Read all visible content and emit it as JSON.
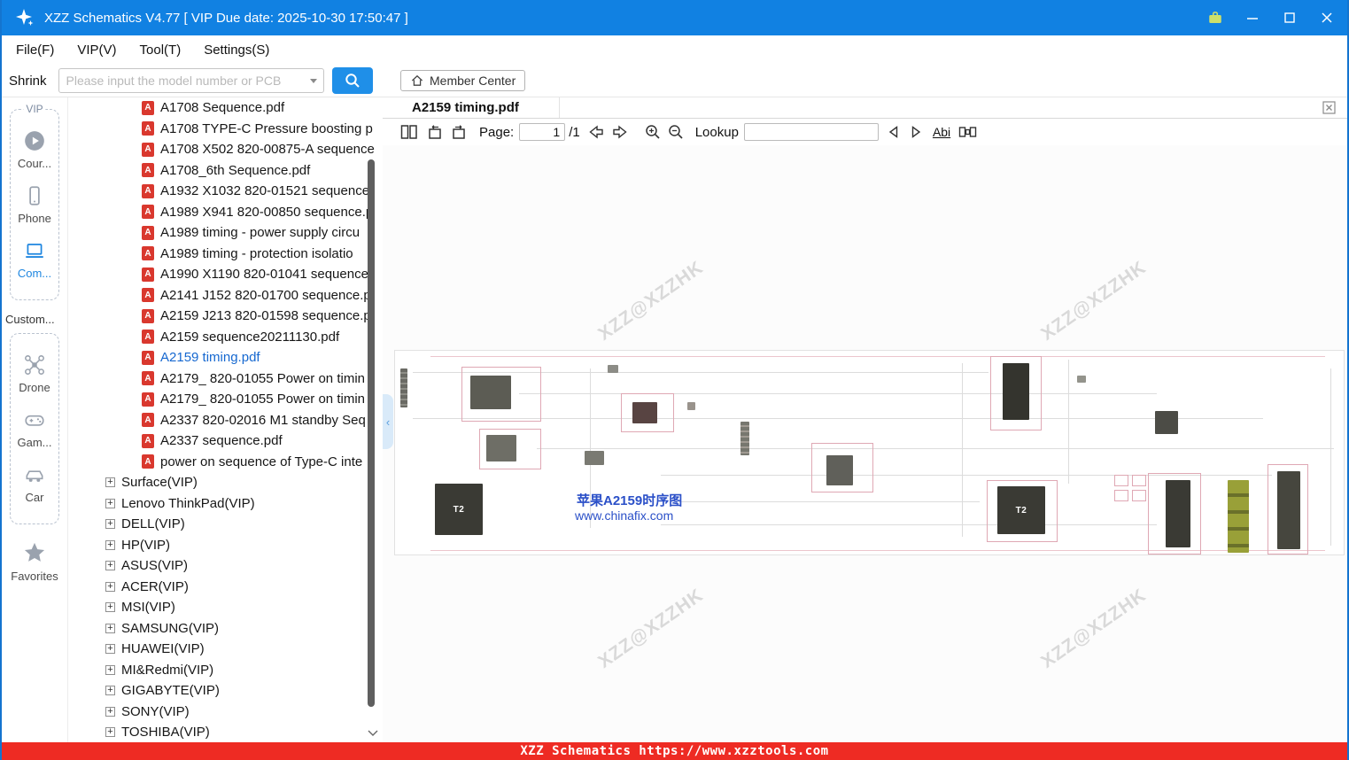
{
  "titlebar": {
    "title": "XZZ Schematics V4.77 [ VIP Due date: 2025-10-30 17:50:47 ]"
  },
  "menubar": {
    "items": [
      "File(F)",
      "VIP(V)",
      "Tool(T)",
      "Settings(S)"
    ]
  },
  "toolbar": {
    "shrink_label": "Shrink",
    "search_placeholder": "Please input the model number or PCB",
    "member_center_label": "Member Center"
  },
  "sidebar": {
    "vip_label": "VIP",
    "courses": "Cour...",
    "phone": "Phone",
    "computer": "Com...",
    "custom_label": "Custom...",
    "drone": "Drone",
    "game": "Gam...",
    "car": "Car",
    "favorites": "Favorites"
  },
  "tree": {
    "files": [
      "A1708 Sequence.pdf",
      "A1708 TYPE-C Pressure boosting p",
      "A1708 X502 820-00875-A sequence",
      "A1708_6th Sequence.pdf",
      "A1932 X1032 820-01521 sequence.",
      "A1989 X941 820-00850 sequence.p",
      "A1989 timing - power supply circu",
      "A1989 timing - protection isolatio",
      "A1990 X1190 820-01041 sequence.",
      "A2141 J152 820-01700 sequence.p",
      "A2159 J213 820-01598 sequence.p",
      "A2159 sequence20211130.pdf",
      "A2159 timing.pdf",
      "A2179_ 820-01055 Power on timin",
      "A2179_ 820-01055 Power on timin",
      "A2337 820-02016 M1 standby Seq",
      "A2337 sequence.pdf",
      "power on sequence of Type-C inte"
    ],
    "folders": [
      "Surface(VIP)",
      "Lenovo ThinkPad(VIP)",
      "DELL(VIP)",
      "HP(VIP)",
      "ASUS(VIP)",
      "ACER(VIP)",
      "MSI(VIP)",
      "SAMSUNG(VIP)",
      "HUAWEI(VIP)",
      "MI&Redmi(VIP)",
      "GIGABYTE(VIP)",
      "SONY(VIP)",
      "TOSHIBA(VIP)"
    ]
  },
  "viewer": {
    "tab": "A2159 timing.pdf",
    "page_label": "Page:",
    "page_value": "1",
    "page_total": "/1",
    "lookup_label": "Lookup",
    "lookup_value": "",
    "abi": "Abi"
  },
  "pdf": {
    "title": "苹果A2159时序图",
    "site": "www.chinafix.com",
    "chip": "T2",
    "watermark": "XZZ@XZZHK"
  },
  "statusbar": {
    "text": "XZZ Schematics https://www.xzztools.com"
  }
}
